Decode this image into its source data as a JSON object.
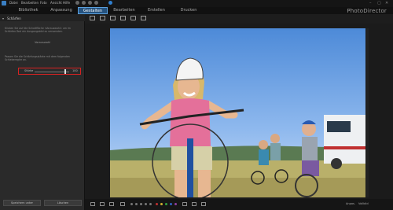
{
  "menu": {
    "items": [
      "Datei",
      "Bearbeiten",
      "Foto",
      "Ansicht",
      "Hilfe"
    ]
  },
  "tabs": [
    {
      "label": "Bibliothek",
      "active": false
    },
    {
      "label": "Anpassung",
      "active": false
    },
    {
      "label": "Gestalten",
      "active": true
    },
    {
      "label": "Bearbeiten",
      "active": false
    },
    {
      "label": "Erstellen",
      "active": false
    },
    {
      "label": "Drucken",
      "active": false
    }
  ],
  "brand": "PhotoDirector",
  "window_controls": [
    "–",
    "▢",
    "✕"
  ],
  "panel": {
    "title": "Schärfen",
    "desc1": "Klicken Sie auf die Schaltfläche »Vorauswahl« um im Schärfen-Tool ein Ausgangsbild zu verwenden.",
    "link": "Vorauswahl",
    "desc2": "Passen Sie die Schärfungsstärke mit dem folgenden Schieberegler an.",
    "slider": {
      "label": "Stärke",
      "value": "100",
      "level": 0.9
    },
    "buttons": {
      "apply": "Speichern unter",
      "cancel": "Löschen"
    }
  },
  "zoom": {
    "label": "Anpas.",
    "value": "Vollbild"
  },
  "colors": {
    "accent": "#26537f",
    "highlight": "#d62222"
  },
  "icons": [
    "thumbnail-icon",
    "compare-icon",
    "split-icon",
    "grid-icon",
    "camera-icon",
    "video-icon"
  ]
}
